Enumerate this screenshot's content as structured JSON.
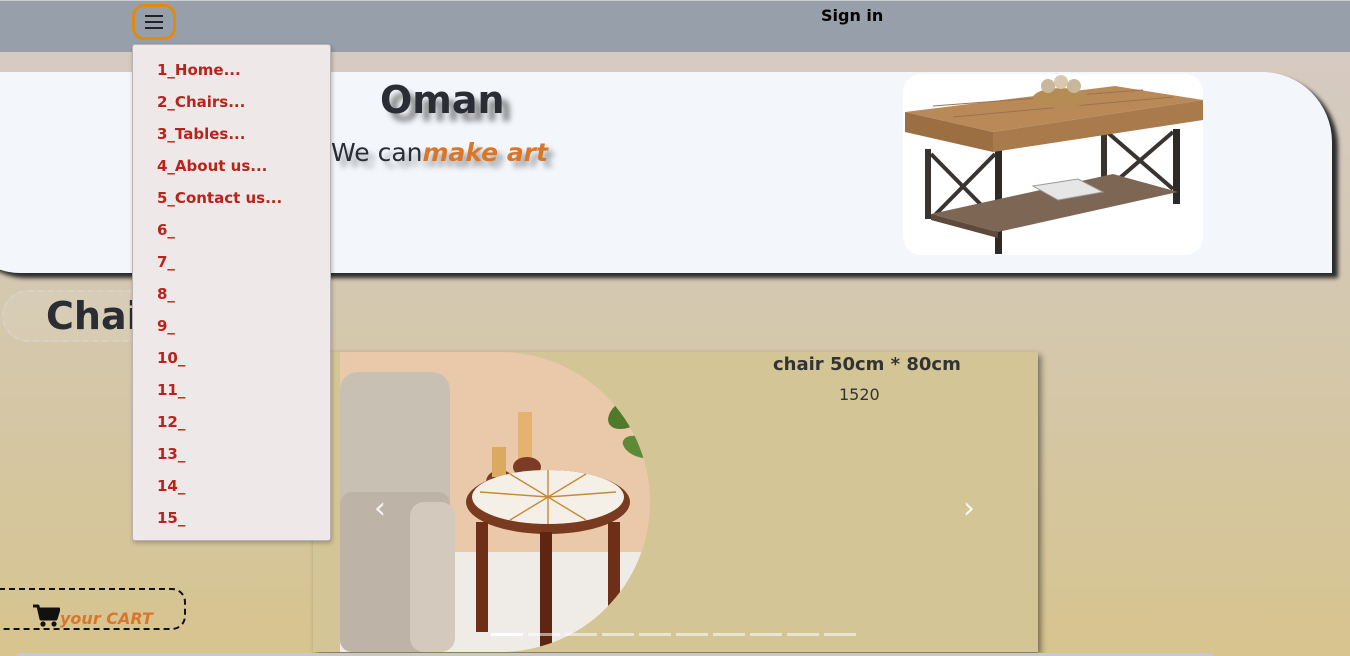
{
  "header": {
    "signin_label": "Sign in"
  },
  "menu": {
    "items": [
      {
        "label": "1_Home..."
      },
      {
        "label": "2_Chairs..."
      },
      {
        "label": "3_Tables..."
      },
      {
        "label": "4_About us..."
      },
      {
        "label": "5_Contact us..."
      },
      {
        "label": "6_"
      },
      {
        "label": "7_"
      },
      {
        "label": "8_"
      },
      {
        "label": "9_"
      },
      {
        "label": "10_"
      },
      {
        "label": "11_"
      },
      {
        "label": "12_"
      },
      {
        "label": "13_"
      },
      {
        "label": "14_"
      },
      {
        "label": "15_"
      }
    ]
  },
  "hero": {
    "title": "Oman",
    "subtitle_prefix": "We can",
    "subtitle_highlight": "make art"
  },
  "section": {
    "label": "Chairs"
  },
  "carousel": {
    "title": "chair 50cm * 80cm",
    "price": "1520",
    "slide_count": 10,
    "active_slide": 1
  },
  "cart": {
    "label": "your CART"
  },
  "colors": {
    "accent": "#d8772b",
    "menu_text": "#b8241b",
    "topbar": "#97a0aa",
    "menu_button_border": "#e08a12"
  },
  "icons": {
    "menu": "hamburger-icon",
    "cart": "cart-icon",
    "prev": "chevron-left-icon",
    "next": "chevron-right-icon"
  }
}
